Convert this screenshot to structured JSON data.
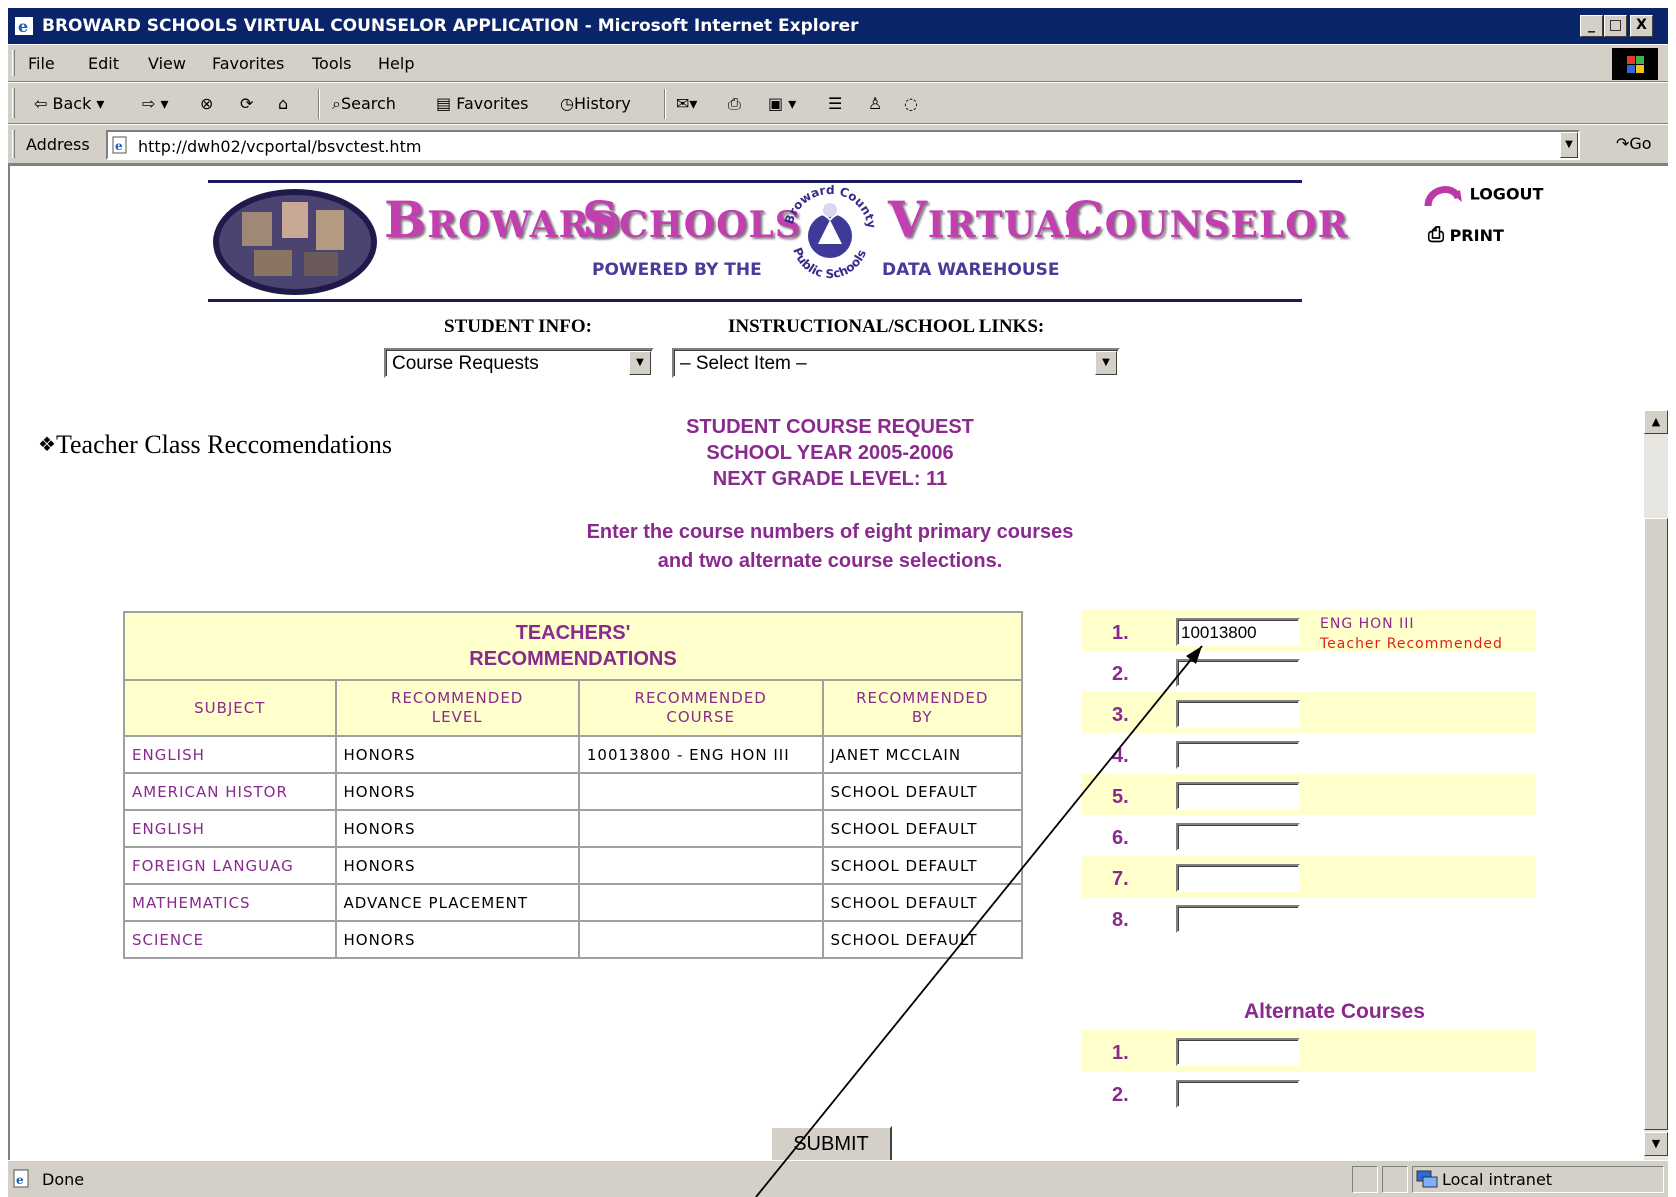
{
  "window": {
    "title": "BROWARD SCHOOLS VIRTUAL COUNSELOR APPLICATION - Microsoft Internet Explorer",
    "controls": [
      "_",
      "□",
      "X"
    ]
  },
  "menu": [
    "File",
    "Edit",
    "View",
    "Favorites",
    "Tools",
    "Help"
  ],
  "toolbar": {
    "back": "Back",
    "search": "Search",
    "favorites": "Favorites",
    "history": "History"
  },
  "address": {
    "label": "Address",
    "url": "http://dwh02/vcportal/bsvctest.htm",
    "go": "Go"
  },
  "banner": {
    "word1_cap": "B",
    "word1_rest": "ROWARD",
    "word2_cap": "S",
    "word2_rest": "CHOOLS",
    "word3_cap": "V",
    "word3_rest": "IRTUAL",
    "word4_cap": "C",
    "word4_rest": "OUNSELOR",
    "powered": "POWERED BY THE",
    "warehouse": "DATA WAREHOUSE",
    "seal_top": "Broward County",
    "seal_bottom": "Public Schools"
  },
  "actions": {
    "logout": "LOGOUT",
    "print": "PRINT"
  },
  "selectors": {
    "student_info_label": "STUDENT INFO:",
    "student_info_value": "Course Requests",
    "links_label": "INSTRUCTIONAL/SCHOOL LINKS:",
    "links_value": "– Select Item –"
  },
  "sidebar": {
    "teacher_link": "Teacher Class Reccomendations"
  },
  "heading": {
    "line1": "STUDENT COURSE REQUEST",
    "line2": "SCHOOL YEAR 2005-2006",
    "line3": "NEXT GRADE LEVEL: 11"
  },
  "instructions": {
    "line1": "Enter the course numbers of eight primary courses",
    "line2": "and two alternate course selections."
  },
  "recommendations": {
    "title_line1": "TEACHERS'",
    "title_line2": "RECOMMENDATIONS",
    "columns": [
      "SUBJECT",
      "RECOMMENDED LEVEL",
      "RECOMMENDED COURSE",
      "RECOMMENDED BY"
    ],
    "rows": [
      [
        "ENGLISH",
        "HONORS",
        "10013800 - ENG HON III",
        "JANET MCCLAIN"
      ],
      [
        "AMERICAN HISTOR",
        "HONORS",
        "",
        "SCHOOL DEFAULT"
      ],
      [
        "ENGLISH",
        "HONORS",
        "",
        "SCHOOL DEFAULT"
      ],
      [
        "FOREIGN LANGUAG",
        "HONORS",
        "",
        "SCHOOL DEFAULT"
      ],
      [
        "MATHEMATICS",
        "ADVANCE PLACEMENT",
        "",
        "SCHOOL DEFAULT"
      ],
      [
        "SCIENCE",
        "HONORS",
        "",
        "SCHOOL DEFAULT"
      ]
    ]
  },
  "primary_courses": [
    {
      "num": "1.",
      "value": "10013800",
      "course_name": "ENG HON III",
      "note": "Teacher Recommended"
    },
    {
      "num": "2.",
      "value": "",
      "course_name": "",
      "note": ""
    },
    {
      "num": "3.",
      "value": "",
      "course_name": "",
      "note": ""
    },
    {
      "num": "4.",
      "value": "",
      "course_name": "",
      "note": ""
    },
    {
      "num": "5.",
      "value": "",
      "course_name": "",
      "note": ""
    },
    {
      "num": "6.",
      "value": "",
      "course_name": "",
      "note": ""
    },
    {
      "num": "7.",
      "value": "",
      "course_name": "",
      "note": ""
    },
    {
      "num": "8.",
      "value": "",
      "course_name": "",
      "note": ""
    }
  ],
  "alternates": {
    "heading": "Alternate Courses",
    "items": [
      {
        "num": "1.",
        "value": ""
      },
      {
        "num": "2.",
        "value": ""
      }
    ]
  },
  "submit_label": "SUBMIT",
  "status": {
    "text": "Done",
    "zone": "Local intranet"
  },
  "colors": {
    "accent": "#8a2a8e",
    "title_pink": "#c23fb0",
    "row_shade": "#ffffcc",
    "recommended_red": "#e02020"
  }
}
